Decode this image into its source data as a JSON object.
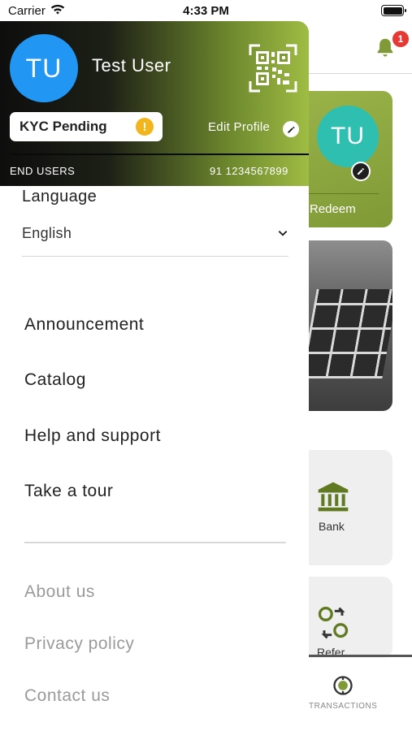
{
  "status_bar": {
    "carrier": "Carrier",
    "time": "4:33 PM"
  },
  "drawer": {
    "avatar_initials": "TU",
    "user_name": "Test User",
    "kyc_status": "KYC Pending",
    "kyc_warning": "!",
    "edit_profile_label": "Edit Profile",
    "role": "END USERS",
    "phone": "91 1234567899",
    "language": {
      "title": "Language",
      "selected": "English"
    },
    "menu": [
      {
        "label": "Announcement"
      },
      {
        "label": "Catalog"
      },
      {
        "label": "Help and support"
      },
      {
        "label": "Take a tour"
      }
    ],
    "footer": [
      {
        "label": "About us"
      },
      {
        "label": "Privacy policy"
      },
      {
        "label": "Contact us"
      }
    ]
  },
  "background": {
    "notification_count": "1",
    "card_initials": "TU",
    "redeem_label": "Redeem",
    "bank_label": "Bank",
    "refer_label": "Refer",
    "transactions_label": "TRANSACTIONS"
  },
  "colors": {
    "avatar": "#2196f3",
    "card_avatar": "#2fbfb0",
    "brand_green": "#9fbc43",
    "kyc_warning": "#f2b51c",
    "badge": "#e53935"
  },
  "icons": [
    "wifi-icon",
    "battery-icon",
    "qr-code-icon",
    "warning-icon",
    "pencil-icon",
    "chevron-down-icon",
    "bell-icon",
    "bank-icon",
    "refer-icon",
    "transactions-icon"
  ]
}
